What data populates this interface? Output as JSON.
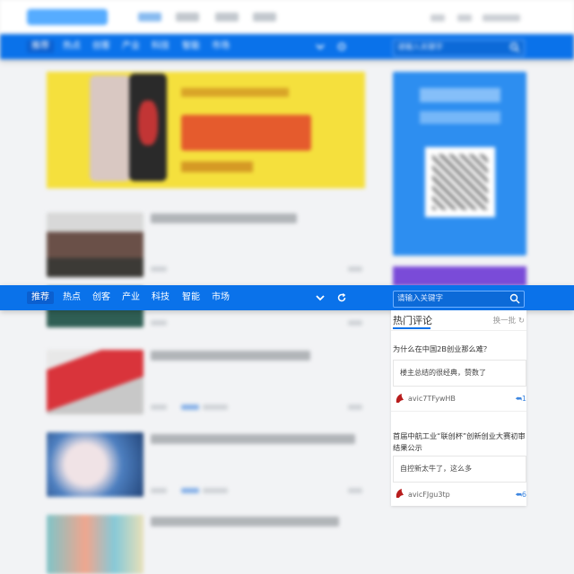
{
  "nav": {
    "items": [
      "推荐",
      "热点",
      "创客",
      "产业",
      "科技",
      "智能",
      "市场"
    ],
    "search_placeholder": "请输入关键字"
  },
  "hot_comments": {
    "title": "热门评论",
    "refresh_label": "换一批",
    "items": [
      {
        "question": "为什么在中国2B创业那么难？",
        "comment": "楼主总结的很经典，赞数了",
        "user": "avic7TFywHB",
        "reply_count": "1"
      },
      {
        "question": "首届中航工业“联创杯”创新创业大赛初审结果公示",
        "comment": "自控新太牛了，这么多",
        "user": "avicFJgu3tp",
        "reply_count": "6"
      }
    ]
  },
  "colors": {
    "nav_bg": "#0a72ea",
    "accent": "#0a72ea"
  },
  "icons": {
    "chevron": "chevron-down-icon",
    "refresh": "refresh-icon",
    "search": "search-icon",
    "reply": "reply-icon"
  }
}
